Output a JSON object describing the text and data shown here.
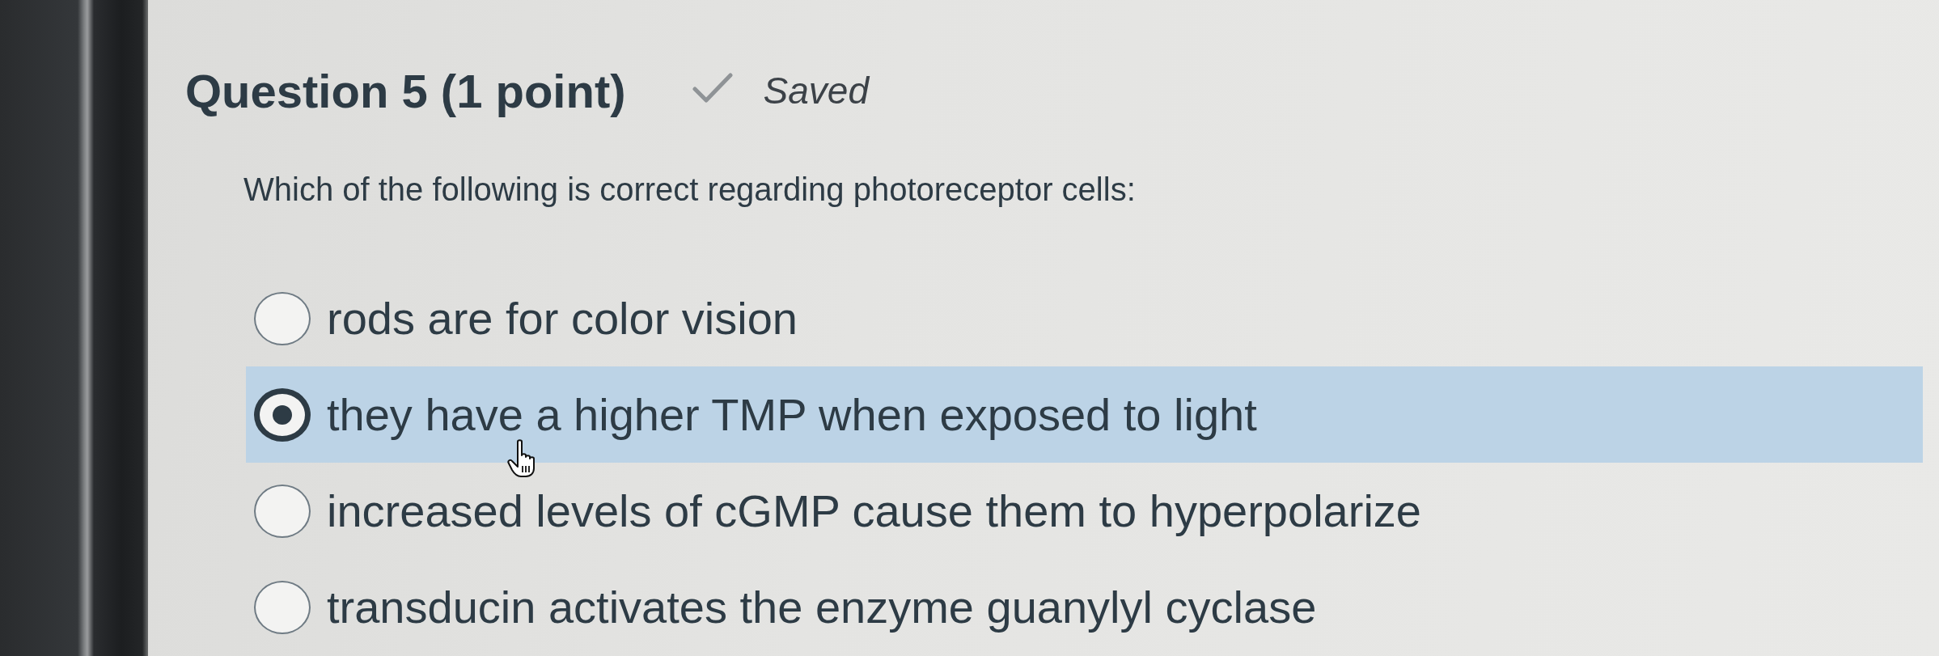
{
  "question": {
    "title": "Question 5 (1 point)",
    "status": {
      "saved": true,
      "label": "Saved"
    },
    "prompt": "Which of the following is correct regarding photoreceptor cells:",
    "options": [
      {
        "label": "rods are for color vision",
        "selected": false
      },
      {
        "label": "they have a higher TMP when exposed to light",
        "selected": true
      },
      {
        "label": "increased levels of cGMP cause them to hyperpolarize",
        "selected": false
      },
      {
        "label": "transducin activates the enzyme guanylyl cyclase",
        "selected": false
      }
    ]
  }
}
